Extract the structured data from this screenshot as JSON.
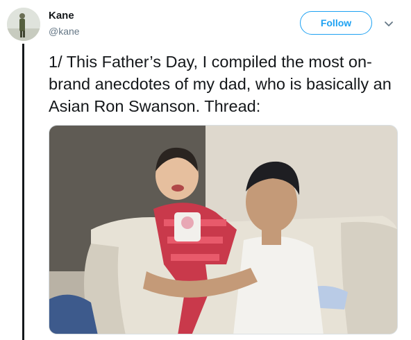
{
  "tweet": {
    "author_name": "Kane",
    "author_handle": "@kane",
    "follow_label": "Follow",
    "text": "1/ This Father’s Day, I compiled the most on-brand anecdotes of my dad, who is basically an Asian Ron Swanson. Thread:"
  },
  "icons": {
    "more": "chevron-down-icon"
  },
  "colors": {
    "accent": "#1da1f2",
    "text": "#14171a",
    "secondary_text": "#657786"
  }
}
